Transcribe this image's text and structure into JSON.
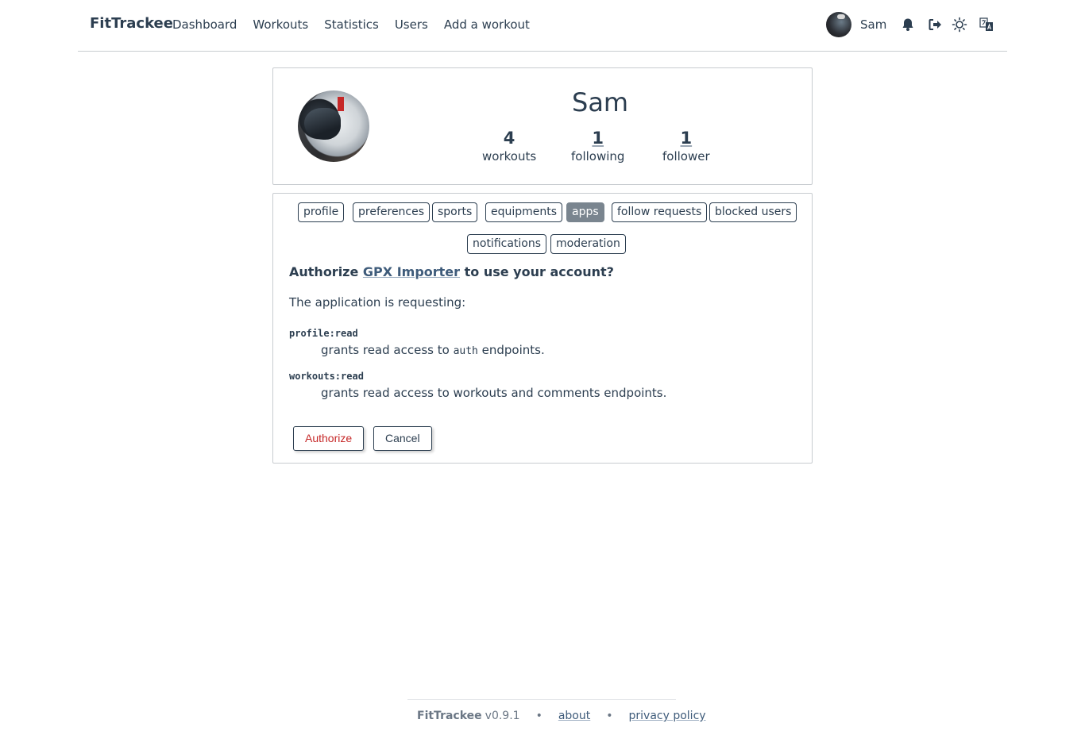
{
  "navbar": {
    "brand": "FitTrackee",
    "links": [
      "Dashboard",
      "Workouts",
      "Statistics",
      "Users",
      "Add a workout"
    ],
    "username": "Sam",
    "icons": [
      "bell-icon",
      "logout-icon",
      "sun-icon",
      "translate-icon"
    ]
  },
  "profile": {
    "name": "Sam",
    "stats": [
      {
        "value": "4",
        "label": "workouts"
      },
      {
        "value": "1",
        "label": "following"
      },
      {
        "value": "1",
        "label": "follower"
      }
    ]
  },
  "tabs": {
    "items": [
      "profile",
      "preferences",
      "sports",
      "equipments",
      "apps",
      "follow requests",
      "blocked users",
      "notifications",
      "moderation"
    ],
    "active": "apps"
  },
  "authorize": {
    "title_prefix": "Authorize",
    "app_name": "GPX Importer",
    "title_suffix": "to use your account?",
    "requesting": "The application is requesting:",
    "scopes": [
      {
        "name": "profile:read",
        "desc_prefix": "grants read access to",
        "desc_code": "auth",
        "desc_suffix": "endpoints."
      },
      {
        "name": "workouts:read",
        "desc_prefix": "grants read access to workouts and comments endpoints.",
        "desc_code": "",
        "desc_suffix": ""
      }
    ],
    "authorize_label": "Authorize",
    "cancel_label": "Cancel"
  },
  "footer": {
    "brand": "FitTrackee",
    "version": "v0.9.1",
    "separator": "•",
    "about": "about",
    "privacy": "privacy policy"
  },
  "colors": {
    "text": "#2c3e50",
    "border": "#c8ccd0",
    "active_tab": "#7a858f",
    "danger": "#c62828",
    "link": "#3e5b7a"
  }
}
